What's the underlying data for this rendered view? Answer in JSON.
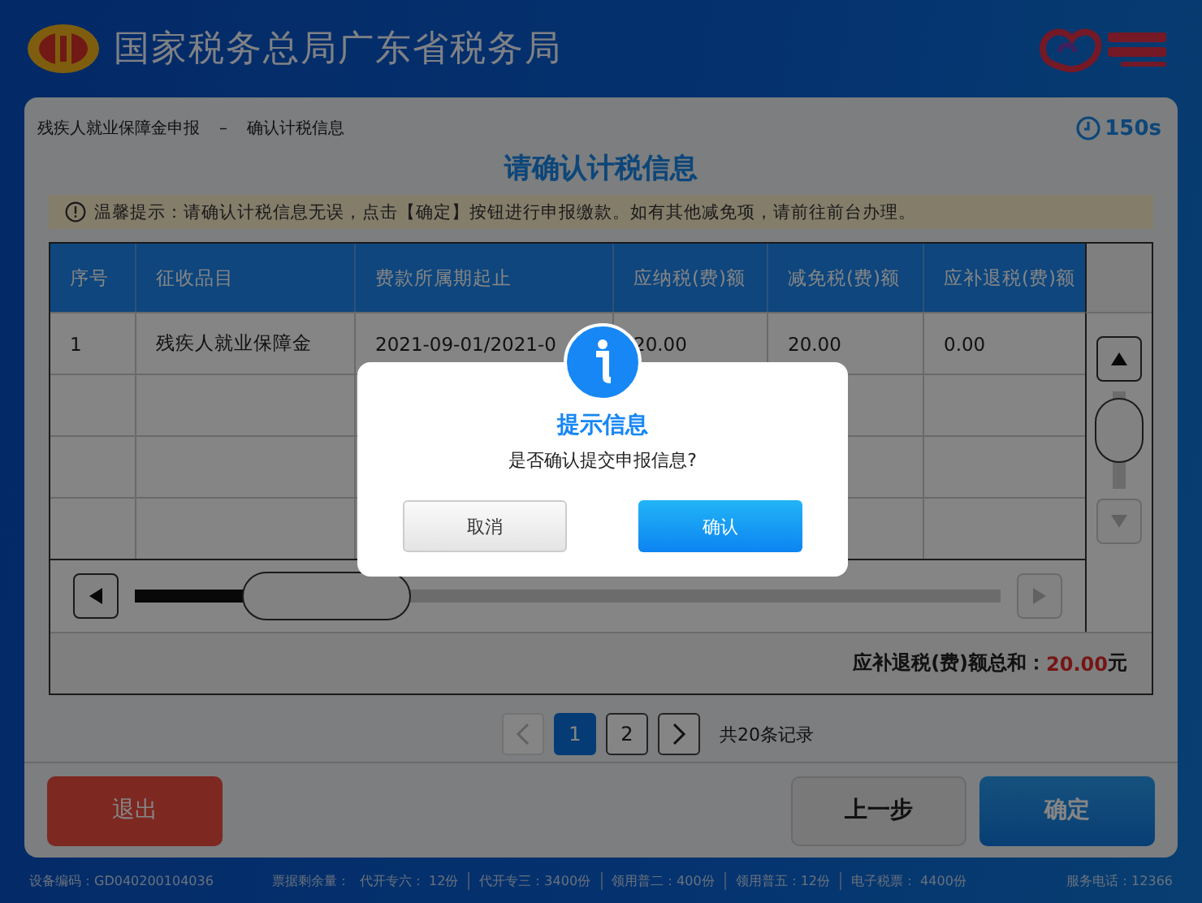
{
  "header": {
    "title": "国家税务总局广东省税务局"
  },
  "breadcrumb": {
    "section": "残疾人就业保障金申报",
    "separator": "–",
    "step": "确认计税信息"
  },
  "timer": "150s",
  "page_title": "请确认计税信息",
  "notice": "温馨提示：请确认计税信息无误，点击【确定】按钮进行申报缴款。如有其他减免项，请前往前台办理。",
  "table": {
    "columns": [
      "序号",
      "征收品目",
      "费款所属期起止",
      "应纳税(费)额",
      "减免税(费)额",
      "应补退税(费)额"
    ],
    "rows": [
      [
        "1",
        "残疾人就业保障金",
        "2021-09-01/2021-0",
        "20.00",
        "20.00",
        "0.00"
      ]
    ],
    "total": {
      "label": "应补退税(费)额总和：",
      "value": "20.00",
      "unit": "元"
    }
  },
  "pagination": {
    "pages": [
      {
        "label": "1",
        "selected": true
      },
      {
        "label": "2",
        "selected": false
      }
    ],
    "records": "共20条记录"
  },
  "buttons": {
    "exit": "退出",
    "back": "上一步",
    "confirm": "确定"
  },
  "status_bar": {
    "device": "设备编码：GD040200104036",
    "stock_label": "票据剩余量：",
    "items": [
      "代开专六：  12份",
      "代开专三：3400份",
      "领用普二：400份",
      "领用普五：12份",
      "电子税票：  4400份"
    ],
    "phone": "服务电话：12366"
  },
  "dialog": {
    "title": "提示信息",
    "message": "是否确认提交申报信息?",
    "cancel": "取消",
    "ok": "确认"
  }
}
